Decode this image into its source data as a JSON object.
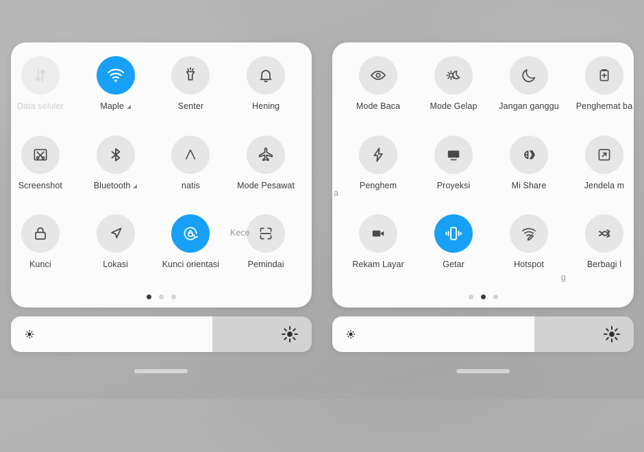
{
  "theme": {
    "accent": "#17a0f5",
    "tile_bg": "#e6e6e6",
    "card_bg": "#fbfbfb",
    "background": "#b0b0b0",
    "label_color": "#3c3c3c",
    "faded_label_color": "#cfcfcf"
  },
  "panels": [
    {
      "id": "control-center-page-1",
      "page_index": 1,
      "page_count": 3,
      "dots": [
        true,
        false,
        false
      ],
      "brightness": {
        "value_percent": 67,
        "low_icon": "brightness-low-icon",
        "high_icon": "brightness-high-icon"
      },
      "ghost_labels": [],
      "tiles": [
        {
          "label": "Data seluler",
          "icon": "data-transfer-icon",
          "state": "faded",
          "expandable": false
        },
        {
          "label": "Maple",
          "icon": "wifi-icon",
          "state": "on",
          "expandable": true
        },
        {
          "label": "Senter",
          "icon": "flashlight-icon",
          "state": "off",
          "expandable": false
        },
        {
          "label": "Hening",
          "icon": "bell-icon",
          "state": "off",
          "expandable": false
        },
        {
          "label": "Screenshot",
          "icon": "screenshot-icon",
          "state": "off",
          "expandable": false
        },
        {
          "label": "Bluetooth",
          "icon": "bluetooth-icon",
          "state": "off",
          "expandable": true
        },
        {
          "label": "natis",
          "icon": "auto-brightness-icon",
          "state": "off",
          "expandable": false
        },
        {
          "label": "Mode Pesawat",
          "icon": "airplane-icon",
          "state": "off",
          "expandable": false
        },
        {
          "label": "Kunci",
          "icon": "lock-icon",
          "state": "off",
          "expandable": false
        },
        {
          "label": "Lokasi",
          "icon": "location-icon",
          "state": "off",
          "expandable": false
        },
        {
          "label": "Kunci orientasi",
          "icon": "rotation-lock-icon",
          "state": "on",
          "expandable": false
        },
        {
          "label": "Pemindai",
          "icon": "scanner-icon",
          "state": "off",
          "expandable": false
        }
      ],
      "partial_label_left": "",
      "partial_label_right": "Kece"
    },
    {
      "id": "control-center-page-2",
      "page_index": 2,
      "page_count": 3,
      "dots": [
        false,
        true,
        false
      ],
      "brightness": {
        "value_percent": 67,
        "low_icon": "brightness-low-icon",
        "high_icon": "brightness-high-icon"
      },
      "ghost_labels": [],
      "tiles": [
        {
          "label": "Mode Baca",
          "icon": "eye-icon",
          "state": "off",
          "expandable": false
        },
        {
          "label": "Mode Gelap",
          "icon": "dark-mode-icon",
          "state": "off",
          "expandable": false
        },
        {
          "label": "Jangan ganggu",
          "icon": "moon-icon",
          "state": "off",
          "expandable": false
        },
        {
          "label": "Penghemat ba",
          "icon": "battery-saver-icon",
          "state": "off",
          "expandable": false
        },
        {
          "label": "Penghem",
          "icon": "lightning-icon",
          "state": "off",
          "expandable": false
        },
        {
          "label": "Proyeksi",
          "icon": "cast-screen-icon",
          "state": "off",
          "expandable": false
        },
        {
          "label": "Mi Share",
          "icon": "mi-share-icon",
          "state": "off",
          "expandable": false
        },
        {
          "label": "Jendela m",
          "icon": "floating-window-icon",
          "state": "off",
          "expandable": false
        },
        {
          "label": "Rekam Layar",
          "icon": "video-camera-icon",
          "state": "off",
          "expandable": false
        },
        {
          "label": "Getar",
          "icon": "vibrate-icon",
          "state": "on",
          "expandable": false
        },
        {
          "label": "Hotspot",
          "icon": "hotspot-icon",
          "state": "off",
          "expandable": false
        },
        {
          "label": "Berbagi l",
          "icon": "share-network-icon",
          "state": "off",
          "expandable": false
        }
      ],
      "partial_label_left": "a",
      "partial_label_right": "g"
    }
  ]
}
